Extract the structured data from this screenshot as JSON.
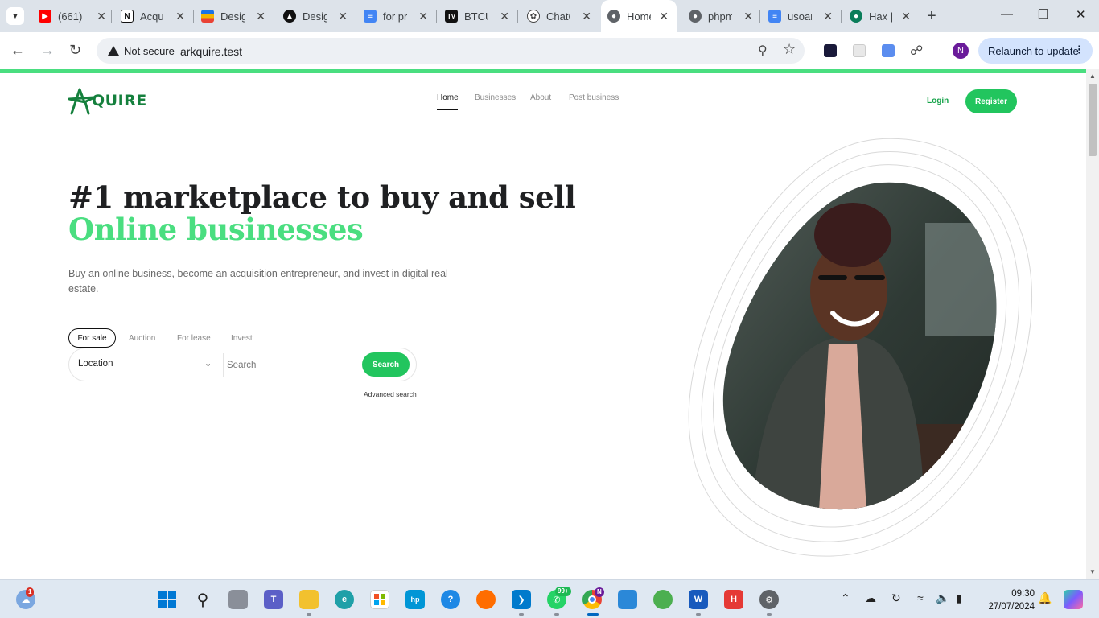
{
  "browser": {
    "tabs": [
      {
        "title": "(661)",
        "icon": "youtube-icon",
        "color": "#ff0000"
      },
      {
        "title": "Acqui",
        "icon": "notion-icon",
        "color": "#111111"
      },
      {
        "title": "Desig",
        "icon": "design-icon",
        "color": "#f4b400"
      },
      {
        "title": "Desig",
        "icon": "triangle-app-icon",
        "color": "#111111"
      },
      {
        "title": "for pr",
        "icon": "google-docs-icon",
        "color": "#4285f4"
      },
      {
        "title": "BTCUS",
        "icon": "tradingview-icon",
        "color": "#111111"
      },
      {
        "title": "ChatG",
        "icon": "chatgpt-icon",
        "color": "#444444"
      },
      {
        "title": "Home",
        "icon": "globe-icon",
        "color": "#5f6368",
        "active": true
      },
      {
        "title": "phpm",
        "icon": "globe-icon",
        "color": "#5f6368"
      },
      {
        "title": "usoar",
        "icon": "google-docs-icon",
        "color": "#4285f4"
      },
      {
        "title": "Hax |",
        "icon": "hax-icon",
        "color": "#0a7d5a"
      }
    ],
    "security_label": "Not secure",
    "url": "arkquire.test",
    "relaunch_label": "Relaunch to update",
    "profile_initial": "N"
  },
  "site": {
    "logo_text": "QUIRE",
    "nav": {
      "home": "Home",
      "businesses": "Businesses",
      "about": "About",
      "post": "Post business"
    },
    "login": "Login",
    "register": "Register",
    "headline_line1": "#1 marketplace to buy and sell",
    "headline_line2": "Online businesses",
    "lead": "Buy an online business, become an acquisition entrepreneur, and invest in digital real estate.",
    "filters": {
      "for_sale": "For sale",
      "auction": "Auction",
      "for_lease": "For lease",
      "invest": "Invest"
    },
    "search": {
      "location": "Location",
      "placeholder": "Search",
      "button": "Search",
      "advanced": "Advanced search"
    },
    "brand_green": "#22c55e",
    "accent_green": "#4ade80"
  },
  "taskbar": {
    "weather_badge": "1",
    "whatsapp_badge": "99+",
    "chrome_badge": "N",
    "time": "09:30",
    "date": "27/07/2024"
  }
}
